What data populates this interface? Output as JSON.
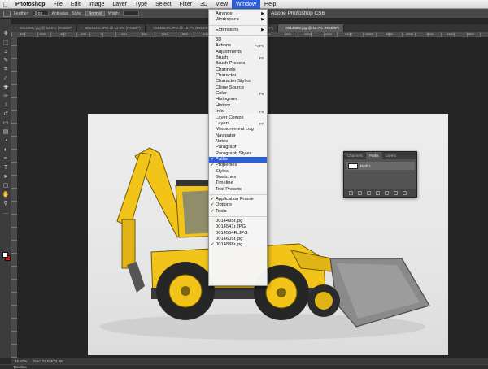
{
  "menubar": {
    "apple": "",
    "items": [
      {
        "label": "Photoshop",
        "kind": "app"
      },
      {
        "label": "File"
      },
      {
        "label": "Edit"
      },
      {
        "label": "Image"
      },
      {
        "label": "Layer"
      },
      {
        "label": "Type"
      },
      {
        "label": "Select"
      },
      {
        "label": "Filter"
      },
      {
        "label": "3D"
      },
      {
        "label": "View"
      },
      {
        "label": "Window",
        "active": true
      },
      {
        "label": "Help"
      }
    ]
  },
  "app_title": "Adobe Photoshop CS6",
  "options_bar": {
    "feather_label": "Feather:",
    "feather_value": "0 px",
    "anti_alias_label": "Anti-alias",
    "style_label": "Style:",
    "style_value": "Normal",
    "width_label": "Width:"
  },
  "doc_tabs": [
    {
      "label": "0014495r.jpg @ 12.5% (RGB/8*)",
      "active": false
    },
    {
      "label": "0014541r.JPG @ 12.5% (RGB/8*)",
      "active": false
    },
    {
      "label": "0014554R.JPG @ 16.7% (RGB/8*)",
      "active": false
    },
    {
      "label": "0014605r.jpg @ 25% (RGB/8*)",
      "active": false
    },
    {
      "label": "0014888r.jpg @ 16.7% (RGB/8*)",
      "active": true
    }
  ],
  "ruler_marks": [
    "800",
    "600",
    "400",
    "200",
    "0",
    "200",
    "400",
    "600",
    "800",
    "1000",
    "1200",
    "1400",
    "1600",
    "1800",
    "2000",
    "2200",
    "2400",
    "2600",
    "2800",
    "3000",
    "3200",
    "3400",
    "3600"
  ],
  "window_menu": [
    {
      "label": "Arrange",
      "submenu": true
    },
    {
      "label": "Workspace",
      "submenu": true
    },
    {
      "sep": true
    },
    {
      "label": "Extensions",
      "submenu": true
    },
    {
      "sep": true
    },
    {
      "label": "3D"
    },
    {
      "label": "Actions",
      "shortcut": "⌥F9"
    },
    {
      "label": "Adjustments"
    },
    {
      "label": "Brush",
      "shortcut": "F5"
    },
    {
      "label": "Brush Presets"
    },
    {
      "label": "Channels"
    },
    {
      "label": "Character"
    },
    {
      "label": "Character Styles"
    },
    {
      "label": "Clone Source"
    },
    {
      "label": "Color",
      "shortcut": "F6"
    },
    {
      "label": "Histogram"
    },
    {
      "label": "History"
    },
    {
      "label": "Info",
      "shortcut": "F8"
    },
    {
      "label": "Layer Comps"
    },
    {
      "label": "Layers",
      "shortcut": "F7"
    },
    {
      "label": "Measurement Log"
    },
    {
      "label": "Navigator"
    },
    {
      "label": "Notes"
    },
    {
      "label": "Paragraph"
    },
    {
      "label": "Paragraph Styles"
    },
    {
      "label": "Paths",
      "checked": true,
      "highlighted": true
    },
    {
      "label": "Properties",
      "checked": true
    },
    {
      "label": "Styles"
    },
    {
      "label": "Swatches"
    },
    {
      "label": "Timeline"
    },
    {
      "label": "Tool Presets"
    },
    {
      "sep": true
    },
    {
      "label": "Application Frame",
      "checked": true
    },
    {
      "label": "Options",
      "checked": true
    },
    {
      "label": "Tools",
      "checked": true
    },
    {
      "sep": true
    },
    {
      "label": "0014495r.jpg"
    },
    {
      "label": "0014541r.JPG"
    },
    {
      "label": "0014554R.JPG"
    },
    {
      "label": "0014605r.jpg"
    },
    {
      "label": "0014888r.jpg",
      "checked": true
    }
  ],
  "paths_panel": {
    "tabs": [
      "Channels",
      "Paths",
      "Layers"
    ],
    "active_tab": "Paths",
    "path_name": "Path 1"
  },
  "status": {
    "zoom": "16.67%",
    "doc_size": "Doc: 72.0M/72.0M"
  },
  "timeline_label": "Timeline",
  "colors": {
    "accent": "#2f5fd8",
    "machine_yellow": "#f2c318",
    "foreground_swatch": "#ffffff",
    "background_swatch": "#e0171d"
  }
}
